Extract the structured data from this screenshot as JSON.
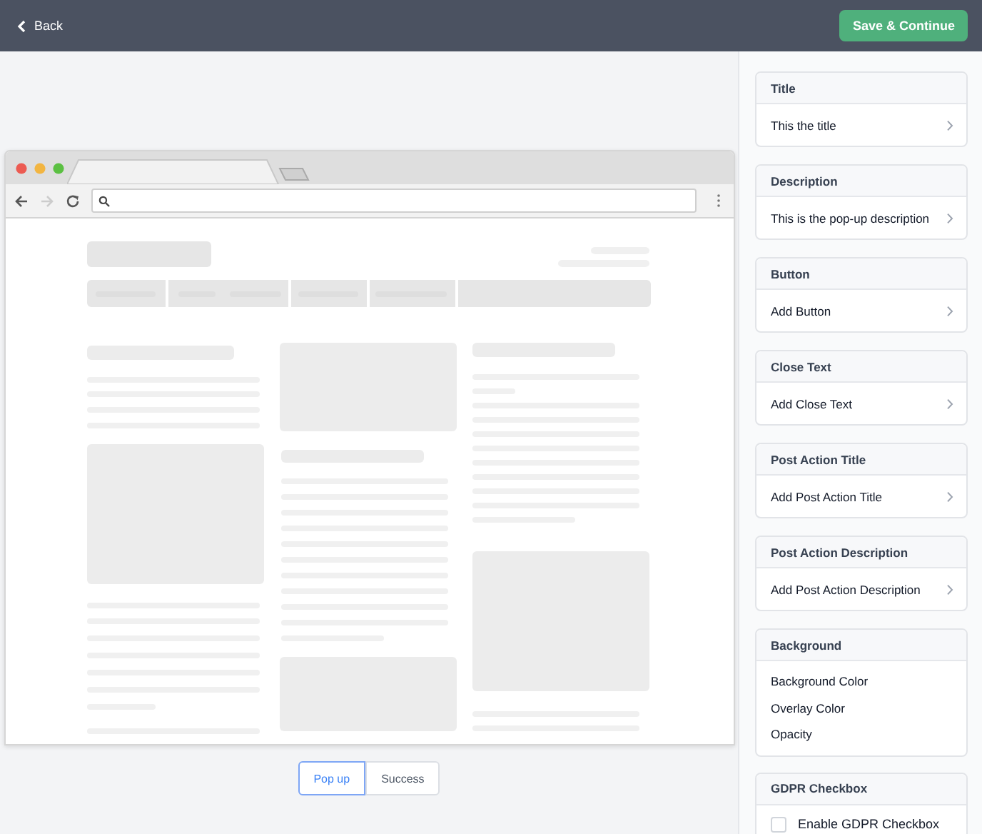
{
  "header": {
    "back": "Back",
    "save": "Save & Continue"
  },
  "preview_tabs": [
    {
      "label": "Pop up",
      "selected": true
    },
    {
      "label": "Success",
      "selected": false
    }
  ],
  "sections": [
    {
      "title": "Title",
      "kind": "link",
      "items": [
        {
          "label": "This the title"
        }
      ]
    },
    {
      "title": "Description",
      "kind": "link",
      "items": [
        {
          "label": "This is the pop-up description"
        }
      ]
    },
    {
      "title": "Button",
      "kind": "link",
      "items": [
        {
          "label": "Add Button"
        }
      ]
    },
    {
      "title": "Close Text",
      "kind": "link",
      "items": [
        {
          "label": "Add Close Text"
        }
      ]
    },
    {
      "title": "Post Action Title",
      "kind": "link",
      "items": [
        {
          "label": "Add Post Action Title"
        }
      ]
    },
    {
      "title": "Post Action Description",
      "kind": "link",
      "items": [
        {
          "label": "Add Post Action Description"
        }
      ]
    },
    {
      "title": "Background",
      "kind": "list",
      "items": [
        {
          "label": "Background Color"
        },
        {
          "label": "Overlay Color"
        },
        {
          "label": "Opacity"
        }
      ]
    },
    {
      "title": "GDPR Checkbox",
      "kind": "checkbox",
      "items": [
        {
          "label": "Enable GDPR Checkbox",
          "checked": false
        }
      ]
    }
  ]
}
